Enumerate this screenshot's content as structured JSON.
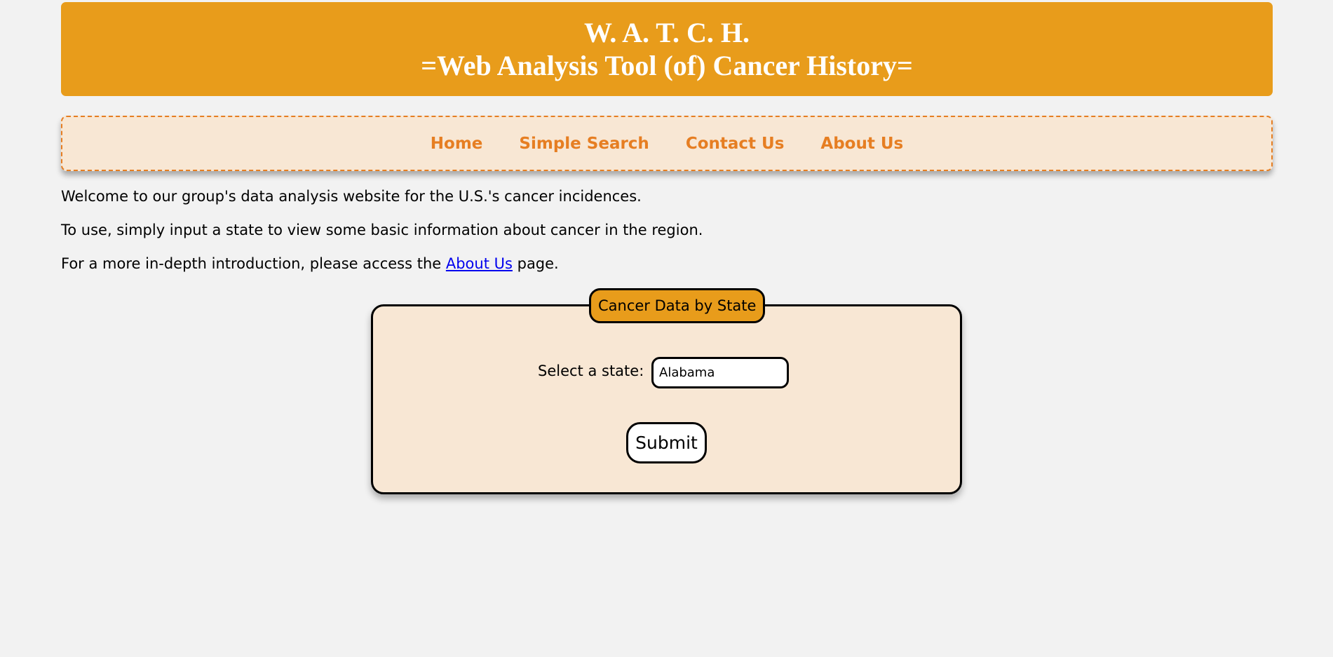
{
  "header": {
    "title_line1": "W. A. T. C. H.",
    "title_line2": "=Web Analysis Tool (of) Cancer History="
  },
  "nav": {
    "items": [
      {
        "label": "Home"
      },
      {
        "label": "Simple Search"
      },
      {
        "label": "Contact Us"
      },
      {
        "label": "About Us"
      }
    ]
  },
  "intro": {
    "line1": "Welcome to our group's data analysis website for the U.S.'s cancer incidences.",
    "line2": "To use, simply input a state to view some basic information about cancer in the region.",
    "line3_prefix": "For a more in-depth introduction, please access the ",
    "line3_link": "About Us",
    "line3_suffix": " page."
  },
  "form": {
    "legend": "Cancer Data by State",
    "state_label": "Select a state:",
    "state_value": "Alabama",
    "submit_label": "Submit"
  },
  "colors": {
    "banner": "#e89c1b",
    "nav_background": "#f8e7d4",
    "nav_link": "#e67e22",
    "page_background": "#f2f2f2",
    "link": "#0000ee"
  }
}
